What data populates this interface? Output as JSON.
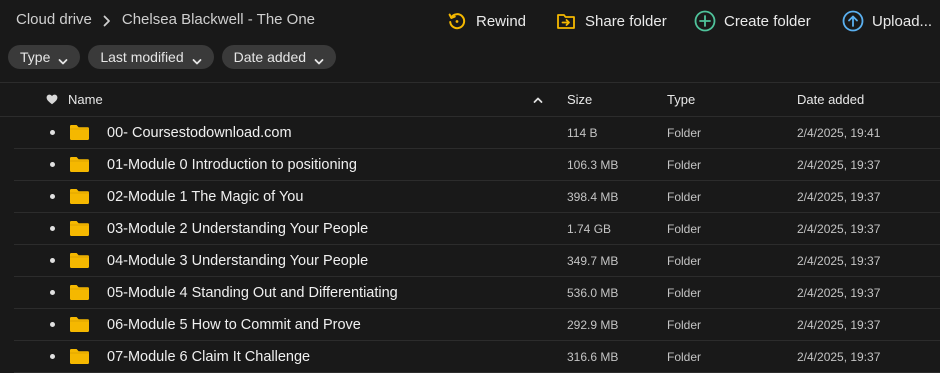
{
  "breadcrumb": {
    "root": "Cloud drive",
    "current": "Chelsea Blackwell - The One"
  },
  "actions": {
    "rewind": "Rewind",
    "share_folder": "Share folder",
    "create_folder": "Create folder",
    "upload": "Upload..."
  },
  "filters": {
    "type": "Type",
    "last_modified": "Last modified",
    "date_added": "Date added"
  },
  "table": {
    "headers": {
      "name": "Name",
      "size": "Size",
      "type": "Type",
      "date_added": "Date added"
    },
    "rows": [
      {
        "name": "00- Coursestodownload.com",
        "size": "114 B",
        "type": "Folder",
        "date": "2/4/2025, 19:41"
      },
      {
        "name": "01-Module 0 Introduction to positioning",
        "size": "106.3 MB",
        "type": "Folder",
        "date": "2/4/2025, 19:37"
      },
      {
        "name": "02-Module 1 The Magic of You",
        "size": "398.4 MB",
        "type": "Folder",
        "date": "2/4/2025, 19:37"
      },
      {
        "name": "03-Module 2 Understanding Your People",
        "size": "1.74 GB",
        "type": "Folder",
        "date": "2/4/2025, 19:37"
      },
      {
        "name": "04-Module 3 Understanding Your People",
        "size": "349.7 MB",
        "type": "Folder",
        "date": "2/4/2025, 19:37"
      },
      {
        "name": "05-Module 4 Standing Out and Differentiating",
        "size": "536.0 MB",
        "type": "Folder",
        "date": "2/4/2025, 19:37"
      },
      {
        "name": "06-Module 5 How to Commit and Prove",
        "size": "292.9 MB",
        "type": "Folder",
        "date": "2/4/2025, 19:37"
      },
      {
        "name": "07-Module 6 Claim It Challenge",
        "size": "316.6 MB",
        "type": "Folder",
        "date": "2/4/2025, 19:37"
      }
    ]
  },
  "icons": {
    "breadcrumb_separator": "chevron-right-icon",
    "rewind": "rewind-icon",
    "share_folder": "share-folder-icon",
    "create_folder": "plus-circle-icon",
    "upload": "upload-arrow-icon",
    "filter_caret": "chevron-down-icon",
    "favourite_column": "heart-icon",
    "sort_indicator": "chevron-up-icon",
    "row_bullet": "dot-icon",
    "row_folder": "folder-icon"
  },
  "colors": {
    "background": "#191919",
    "chip": "#3a3a3a",
    "folder": "#f5b800",
    "rewind_icon": "#f5b800",
    "share_icon": "#f5b800",
    "create_icon": "#4fc39b",
    "upload_icon": "#5ab0f0",
    "divider": "#2c2c2c"
  }
}
